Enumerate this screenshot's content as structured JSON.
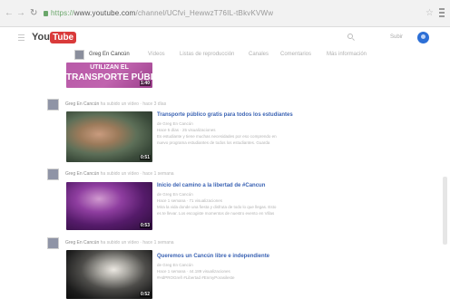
{
  "browser": {
    "url_scheme": "https://",
    "url_host": "www.youtube.com",
    "url_path": "/channel/UCfvi_HewwzT76IL-tBkvKVWw"
  },
  "youtube": {
    "logo_you": "You",
    "logo_tube": "Tube",
    "upload_label": "Subir"
  },
  "channel": {
    "name": "Greg En Cancún",
    "tabs": [
      "Vídeos",
      "Listas de reproducción",
      "Canales",
      "Comentarios",
      "Más información"
    ]
  },
  "top_video": {
    "caption_line1": "UTILIZAN EL",
    "caption_line2": "TRANSPORTE PÚBLICO",
    "duration": "1:40"
  },
  "feed": [
    {
      "actor": "Greg En Cancún",
      "action": " ha subido un vídeo",
      "time": "hace 3 días",
      "title": "Transporte público gratis para todos los estudiantes",
      "author": "de Greg En Cancún",
      "stats": "Hace 5 días · 25 visualizaciones",
      "desc1": "Es estudiante y tiene muchas necesidades por eso comprendo en",
      "desc2": "nuevo programa estudiantes de todos los estudiantes. Guarda",
      "duration": "0:51"
    },
    {
      "actor": "Greg En Cancún",
      "action": " ha subido un vídeo",
      "time": "hace 1 semana",
      "title": "Inicio del camino a la libertad de #Cancun",
      "author": "de Greg En Cancún",
      "stats": "Hace 1 semana · 71 visualizaciones",
      "desc1": "Mira la vida donde una fiesta y disfruta de todo lo que llegas. Esto",
      "desc2": "es te llevar. Los escogiste momentos de nuestro evento en Villas",
      "duration": "0:53"
    },
    {
      "actor": "Greg En Cancún",
      "action": " ha subido un vídeo",
      "time": "hace 1 semana",
      "title": "Queremos un Cancún libre e independiente",
      "author": "de Greg En Cancún",
      "stats": "Hace 1 semana · 44.189 visualizaciones",
      "desc1": "#HdPROGreñ #Libertad #EnmyPorasileste",
      "desc2": "",
      "duration": "0:52"
    }
  ]
}
